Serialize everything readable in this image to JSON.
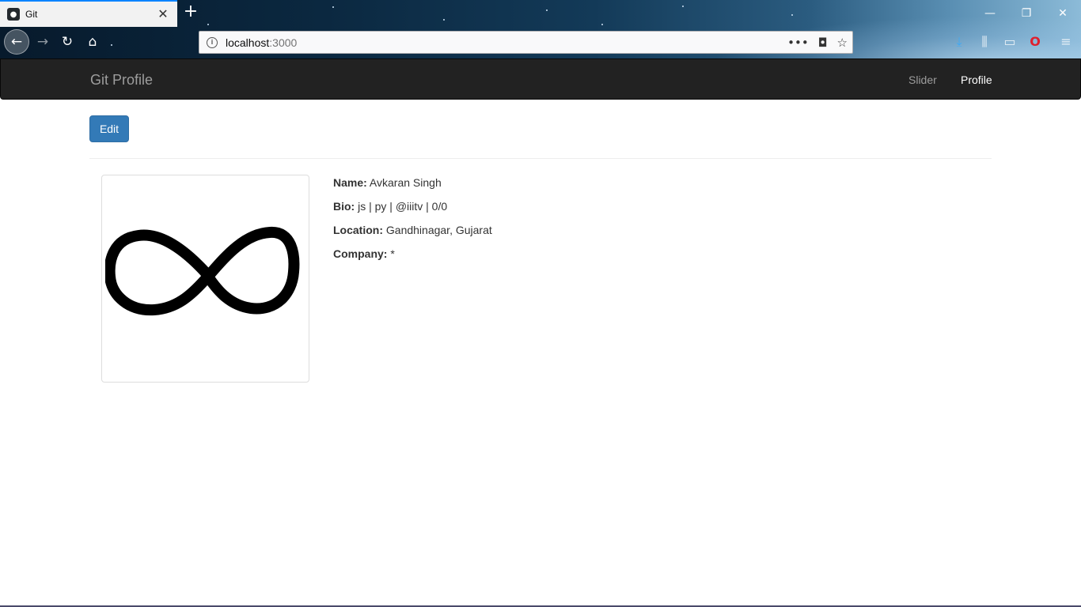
{
  "browser": {
    "tab_title": "Git",
    "new_tab_label": "+",
    "url_host": "localhost",
    "url_port": ":3000",
    "window_controls": [
      "minimize-icon",
      "restore-icon",
      "close-icon"
    ],
    "toolbar_icons": [
      "download-icon",
      "library-icon",
      "sidebar-icon",
      "opera-icon",
      "menu-icon"
    ]
  },
  "navbar": {
    "brand": "Git Profile",
    "links": [
      "Slider",
      "Profile"
    ],
    "active": "Profile"
  },
  "actions": {
    "edit_label": "Edit"
  },
  "profile": {
    "avatar_icon": "infinity-icon",
    "fields": [
      {
        "label": "Name:",
        "value": "Avkaran Singh"
      },
      {
        "label": "Bio:",
        "value": "js | py | @iiitv | 0/0"
      },
      {
        "label": "Location:",
        "value": "Gandhinagar, Gujarat"
      },
      {
        "label": "Company:",
        "value": "*"
      }
    ]
  },
  "colors": {
    "navbar_bg": "#222222",
    "primary": "#337ab7",
    "tab_accent": "#0a84ff"
  }
}
